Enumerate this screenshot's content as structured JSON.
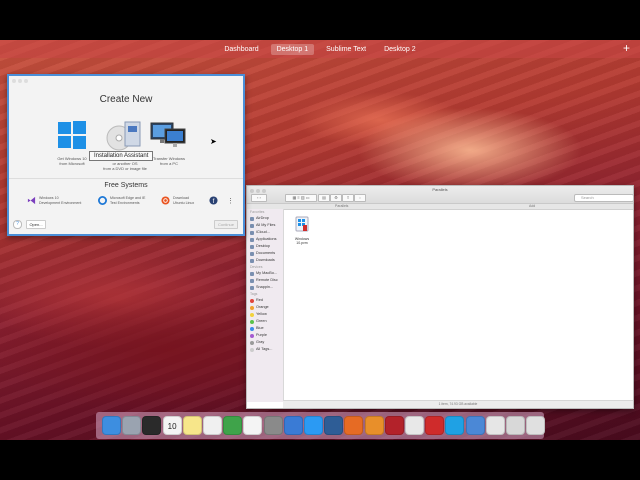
{
  "spaces": {
    "items": [
      "Dashboard",
      "Desktop 1",
      "Sublime Text",
      "Desktop 2"
    ],
    "active_index": 1,
    "add_label": "+"
  },
  "parallels": {
    "heading": "Create New",
    "option_windows": [
      "Get Windows 10",
      "from Microsoft"
    ],
    "option_dvd": [
      "Install Windows",
      "or another OS",
      "from a DVD or image file"
    ],
    "option_pc": [
      "Transfer Windows",
      "from a PC"
    ],
    "tooltip": "Installation Assistant",
    "free_heading": "Free Systems",
    "free_vs": [
      "Windows 10",
      "Development Environment"
    ],
    "free_edge": [
      "Microsoft Edge and IE",
      "Test Environments"
    ],
    "free_ubuntu": [
      "Download",
      "Ubuntu Linux"
    ],
    "help_label": "?",
    "open_label": "Open...",
    "continue_label": "Continue"
  },
  "finder": {
    "title": "Parallels",
    "search_placeholder": "Search",
    "path_left": "Parallels",
    "path_right": "Add",
    "favorites_heading": "Favorites",
    "favorites": [
      "AirDrop",
      "All My Files",
      "iCloud...",
      "Applications",
      "Desktop",
      "Documents",
      "Downloads"
    ],
    "devices_heading": "Devices",
    "devices": [
      "My MacBo...",
      "Remote Disc",
      "Snappin..."
    ],
    "tags_heading": "Tags",
    "tags": [
      {
        "label": "Red",
        "color": "#e0443c"
      },
      {
        "label": "Orange",
        "color": "#f0a030"
      },
      {
        "label": "Yellow",
        "color": "#f2d23c"
      },
      {
        "label": "Green",
        "color": "#5bc24a"
      },
      {
        "label": "Blue",
        "color": "#3b8be8"
      },
      {
        "label": "Purple",
        "color": "#a45bd0"
      },
      {
        "label": "Gray",
        "color": "#9a9a9a"
      },
      {
        "label": "All Tags...",
        "color": "#cccccc"
      }
    ],
    "file_label": "Windows 10.pvm",
    "status": "1 item, 74.93 GB available"
  },
  "dock": {
    "icons": [
      {
        "name": "finder-icon",
        "color": "#3d8ee0"
      },
      {
        "name": "launchpad-icon",
        "color": "#9aa3b0"
      },
      {
        "name": "terminal-icon",
        "color": "#2a2a2a"
      },
      {
        "name": "calendar-icon",
        "color": "#f4f4f4",
        "text": "10"
      },
      {
        "name": "notes-icon",
        "color": "#f7e68a"
      },
      {
        "name": "keynote-icon",
        "color": "#f0f0f0"
      },
      {
        "name": "numbers-icon",
        "color": "#3fa34a"
      },
      {
        "name": "itunes-icon",
        "color": "#f4f4f4"
      },
      {
        "name": "system-preferences-icon",
        "color": "#8a8a8a"
      },
      {
        "name": "keynote-podium-icon",
        "color": "#3a7bd5"
      },
      {
        "name": "app-store-icon",
        "color": "#2b9af3"
      },
      {
        "name": "quicktime-icon",
        "color": "#2e5d96"
      },
      {
        "name": "firefox-icon",
        "color": "#e66b24"
      },
      {
        "name": "sublime-text-icon",
        "color": "#e88f2a"
      },
      {
        "name": "filezilla-icon",
        "color": "#b3222a"
      },
      {
        "name": "chrome-icon",
        "color": "#e8e8e8"
      },
      {
        "name": "parallels-icon",
        "color": "#cf2b2b"
      },
      {
        "name": "skype-icon",
        "color": "#1fa1e4"
      },
      {
        "name": "preview-icon",
        "color": "#4b88d6"
      },
      {
        "name": "mail-icon",
        "color": "#e6e6e6"
      },
      {
        "name": "documents-stack-icon",
        "color": "#d8d8d8"
      },
      {
        "name": "trash-icon",
        "color": "#e0e0e0"
      }
    ]
  }
}
